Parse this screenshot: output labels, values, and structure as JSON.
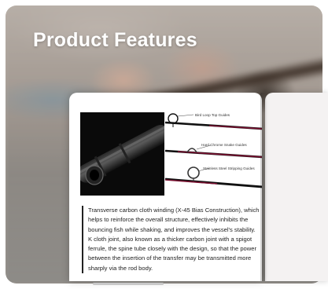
{
  "title": "Product Features",
  "diagram": {
    "labels": [
      "Bird Loop Top Guides",
      "Hard Chrome Snake Guides",
      "Stainless Steel Stripping Guides"
    ]
  },
  "description": {
    "paragraph_1": "Transverse carbon cloth winding (X-45 Bias Construction), which helps to reinforce the overall structure, effectively inhibits the bouncing fish while shaking, and improves the vessel's stability.",
    "paragraph_2": "K cloth joint, also known as a thicker carbon joint with a spigot ferrule, the spine tube closely with the design, so that the power between the insertion of the transfer may be transmitted more sharply via the rod body."
  },
  "colors": {
    "title_text": "#ffffff",
    "body_text": "#222222",
    "rod_accent": "#7a1030"
  },
  "icons": {
    "rod-closeup": "photo",
    "guide-diagram": "diagram"
  }
}
